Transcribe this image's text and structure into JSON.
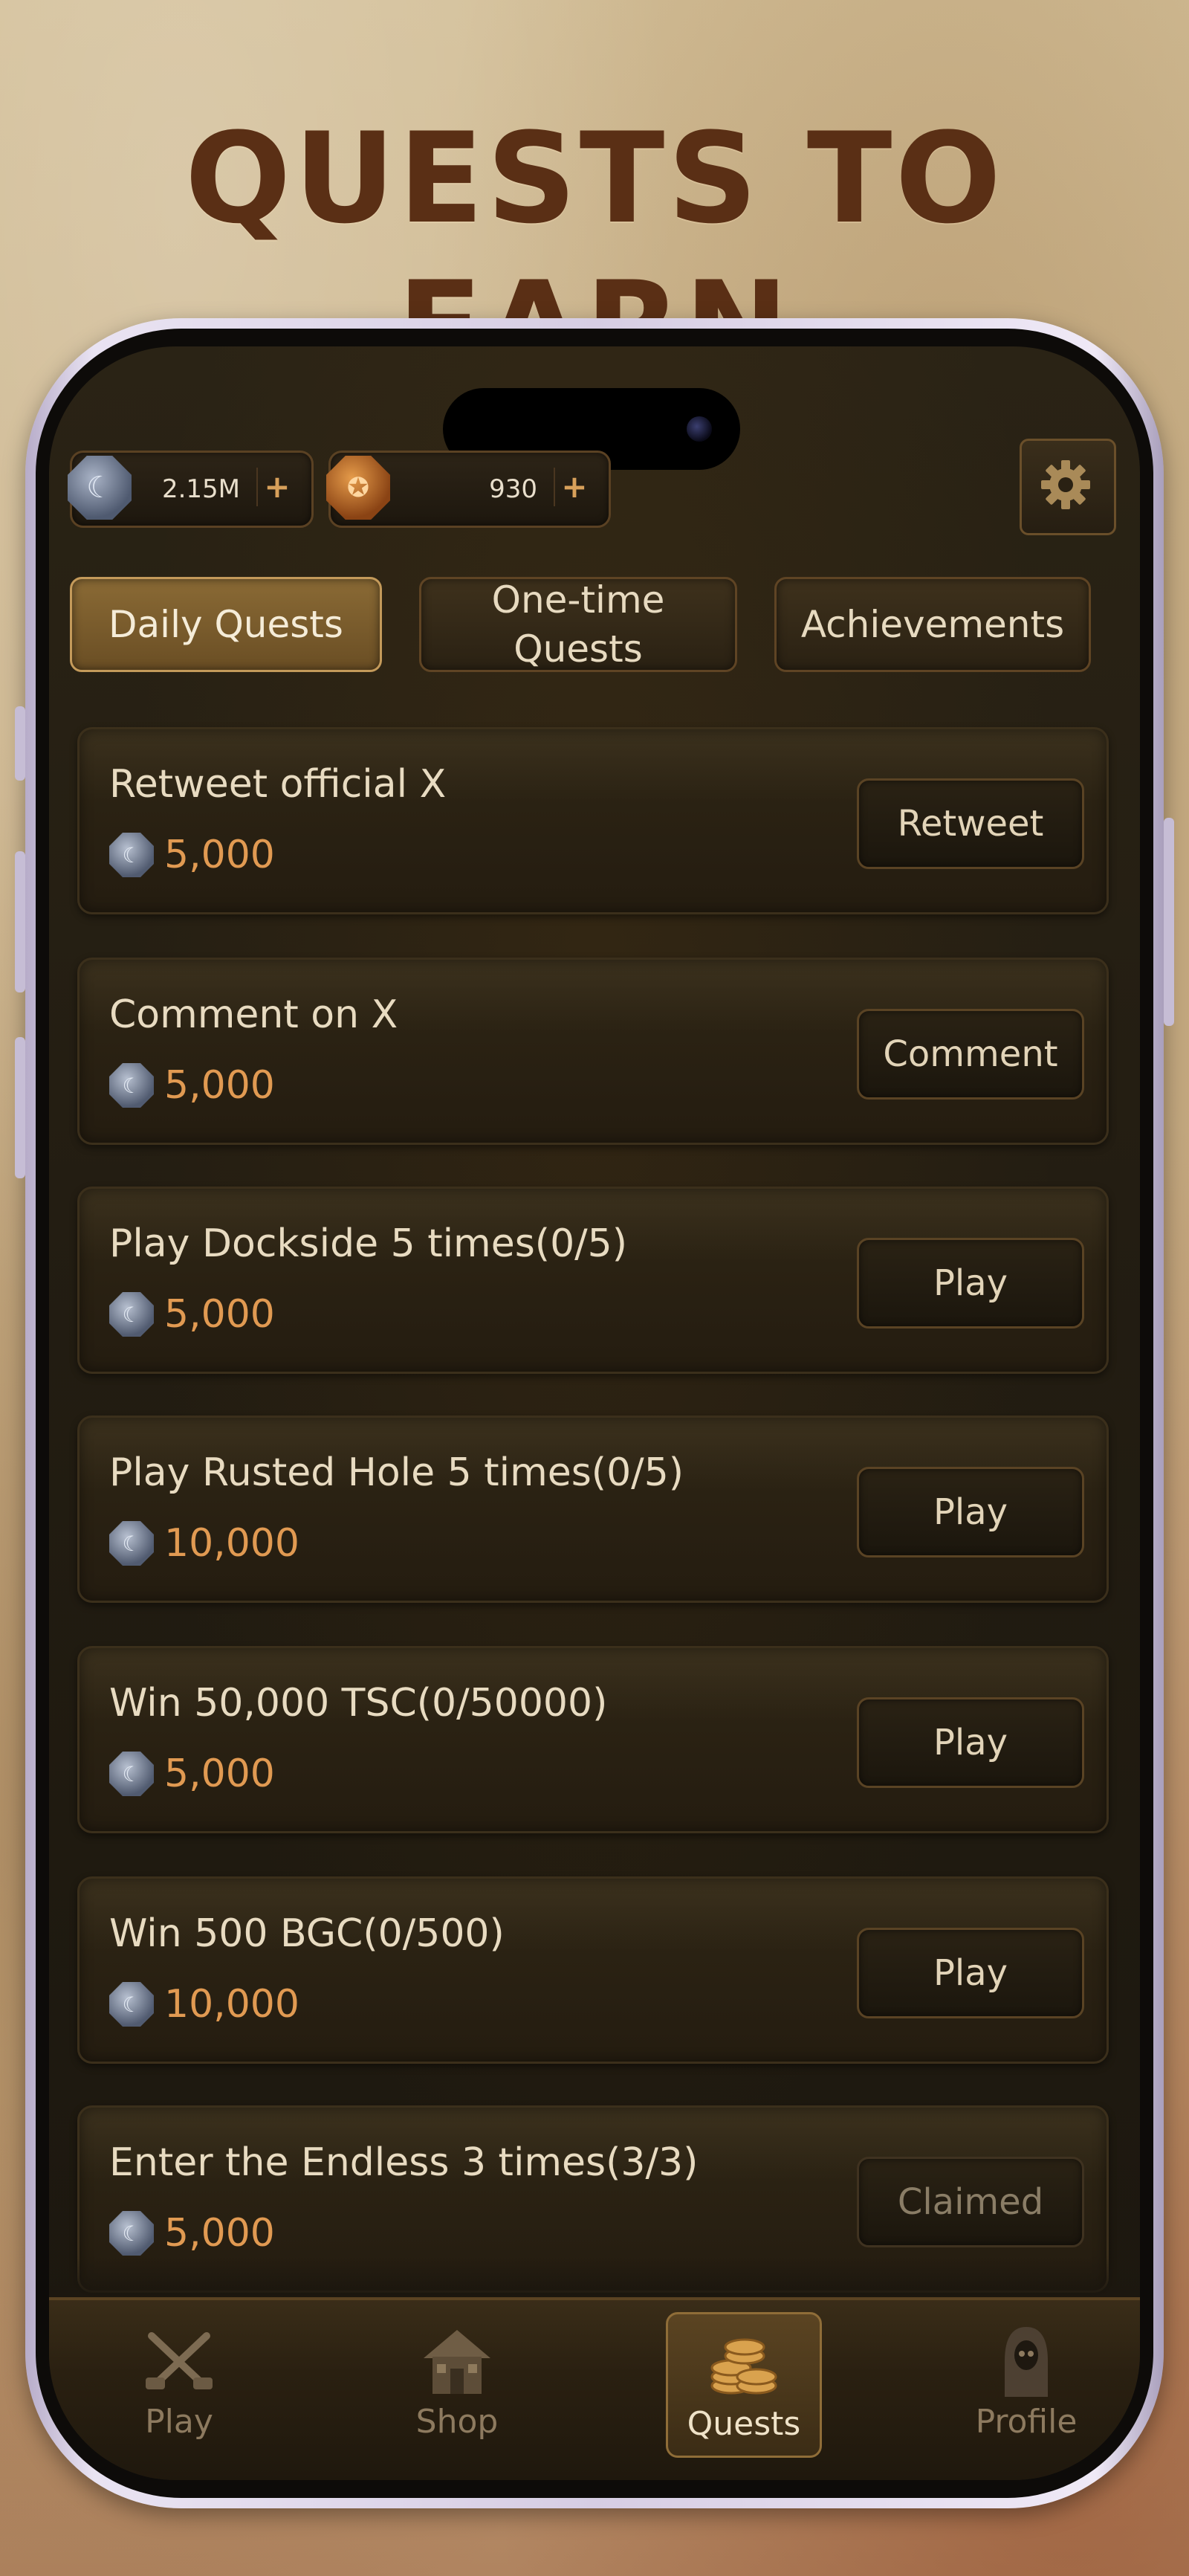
{
  "headline": "QUESTS TO EARN",
  "currencies": [
    {
      "icon": "silver-coin-icon",
      "value": "2.15M",
      "plus": "+"
    },
    {
      "icon": "gold-coin-icon",
      "value": "930",
      "plus": "+"
    }
  ],
  "settings": {
    "icon": "gear-icon"
  },
  "tabs": [
    {
      "label": "Daily Quests",
      "active": true
    },
    {
      "label": "One-time\nQuests",
      "active": false
    },
    {
      "label": "Achievements",
      "active": false
    }
  ],
  "quests": [
    {
      "title": "Retweet official X",
      "reward": "5,000",
      "action": "Retweet"
    },
    {
      "title": "Comment on X",
      "reward": "5,000",
      "action": "Comment"
    },
    {
      "title": "Play Dockside 5 times(0/5)",
      "reward": "5,000",
      "action": "Play"
    },
    {
      "title": "Play Rusted Hole 5 times(0/5)",
      "reward": "10,000",
      "action": "Play"
    },
    {
      "title": "Win 50,000 TSC(0/50000)",
      "reward": "5,000",
      "action": "Play"
    },
    {
      "title": "Win 500 BGC(0/500)",
      "reward": "10,000",
      "action": "Play"
    },
    {
      "title": "Enter the Endless 3 times(3/3)",
      "reward": "5,000",
      "action": "Claimed"
    }
  ],
  "nav": [
    {
      "label": "Play",
      "icon": "crossed-guns-icon"
    },
    {
      "label": "Shop",
      "icon": "shop-house-icon"
    },
    {
      "label": "Quests",
      "icon": "coin-stack-icon",
      "active": true
    },
    {
      "label": "Profile",
      "icon": "reaper-icon"
    }
  ],
  "colors": {
    "accent_orange": "#e19a52",
    "text_light": "#e8dbc1",
    "headline_brown": "#5a2f15",
    "active_tab": "#8a6a35"
  }
}
